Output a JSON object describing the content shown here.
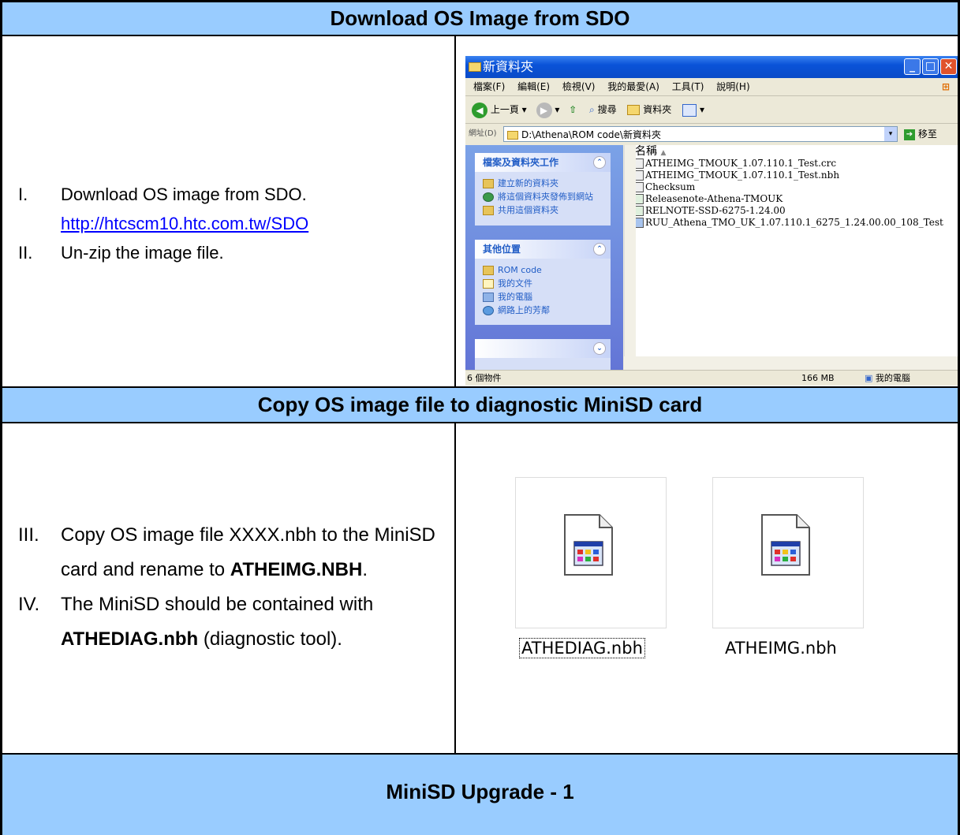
{
  "sections": {
    "download_title": "Download OS Image from SDO",
    "copy_title": "Copy OS image file to diagnostic MiniSD card",
    "footer_title": "MiniSD Upgrade - 1"
  },
  "download_steps": [
    {
      "num": "I.",
      "text": "Download OS image from SDO.",
      "link": "http://htcscm10.htc.com.tw/SDO"
    },
    {
      "num": "II.",
      "text": "Un-zip the image file."
    }
  ],
  "copy_steps": [
    {
      "num": "III.",
      "text_before": "Copy OS image file XXXX.nbh to the MiniSD card and rename to ",
      "bold": "ATHEIMG.NBH",
      "text_after": "."
    },
    {
      "num": "IV.",
      "text_before": "The MiniSD should be contained with ",
      "bold": "ATHEDIAG.nbh",
      "text_after": " (diagnostic tool)."
    }
  ],
  "explorer": {
    "title": "新資料夾",
    "menu": [
      "檔案(F)",
      "編輯(E)",
      "檢視(V)",
      "我的最愛(A)",
      "工具(T)",
      "說明(H)"
    ],
    "toolbar": {
      "back": "上一頁",
      "search": "搜尋",
      "folders": "資料夾"
    },
    "address_label": "網址(D)",
    "address": "D:\\Athena\\ROM code\\新資料夾",
    "go": "移至",
    "task_panel": {
      "title": "檔案及資料夾工作",
      "items": [
        "建立新的資料夾",
        "將這個資料夾發佈到網站",
        "共用這個資料夾"
      ]
    },
    "other_panel": {
      "title": "其他位置",
      "items": [
        "ROM code",
        "我的文件",
        "我的電腦",
        "網路上的芳鄰"
      ]
    },
    "column_header": "名稱",
    "files": [
      "ATHEIMG_TMOUK_1.07.110.1_Test.crc",
      "ATHEIMG_TMOUK_1.07.110.1_Test.nbh",
      "Checksum",
      "Releasenote-Athena-TMOUK",
      "RELNOTE-SSD-6275-1.24.00",
      "RUU_Athena_TMO_UK_1.07.110.1_6275_1.24.00.00_108_Test"
    ],
    "status": {
      "count": "6 個物件",
      "size": "166 MB",
      "location": "我的電腦"
    }
  },
  "file_icons": [
    {
      "name": "ATHEDIAG.nbh"
    },
    {
      "name": "ATHEIMG.nbh"
    }
  ]
}
